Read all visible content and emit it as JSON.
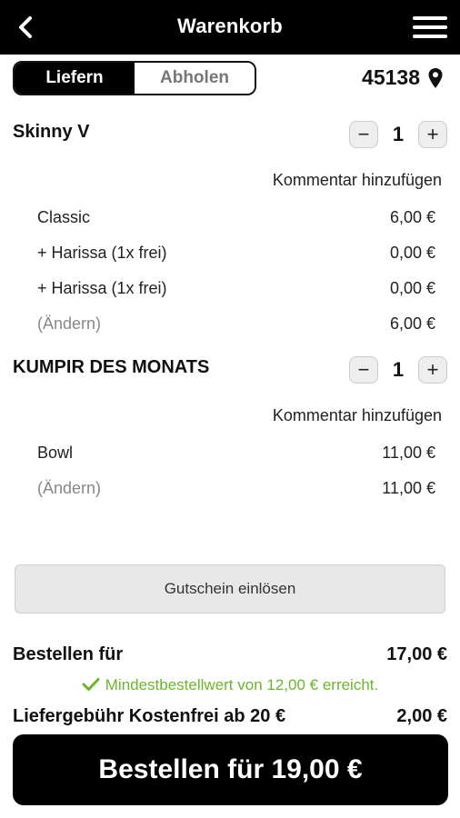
{
  "header": {
    "title": "Warenkorb"
  },
  "mode": {
    "deliver_label": "Liefern",
    "pickup_label": "Abholen",
    "zip": "45138"
  },
  "items": [
    {
      "name": "Skinny V",
      "quantity": "1",
      "comment_label": "Kommentar hinzufügen",
      "lines": [
        {
          "label": "Classic",
          "price": "6,00 €"
        },
        {
          "label": "+ Harissa (1x frei)",
          "price": "0,00 €"
        },
        {
          "label": "+ Harissa (1x frei)",
          "price": "0,00 €"
        },
        {
          "label": "(Ändern)",
          "price": "6,00 €"
        }
      ]
    },
    {
      "name": "KUMPIR DES MONATS",
      "quantity": "1",
      "comment_label": "Kommentar hinzufügen",
      "lines": [
        {
          "label": "Bowl",
          "price": "11,00 €"
        },
        {
          "label": "(Ändern)",
          "price": "11,00 €"
        }
      ]
    }
  ],
  "voucher_label": "Gutschein einlösen",
  "summary": {
    "order_for_label": "Bestellen für",
    "order_for_value": "17,00 €",
    "min_order_msg": "Mindestbestellwert von 12,00 € erreicht.",
    "delivery_fee_label": "Liefergebühr Kostenfrei ab 20 €",
    "delivery_fee_value": "2,00 €"
  },
  "order_button_label": "Bestellen für 19,00 €",
  "colors": {
    "success": "#6ab62a",
    "primary": "#000000"
  },
  "icons": {
    "back": "chevron-left-icon",
    "menu": "hamburger-menu-icon",
    "location": "location-pin-icon",
    "check": "checkmark-icon"
  }
}
